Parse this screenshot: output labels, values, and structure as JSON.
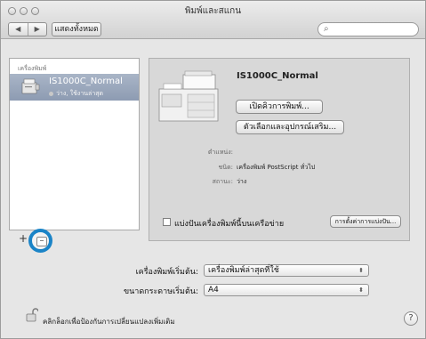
{
  "window": {
    "title": "พิมพ์และสแกน"
  },
  "toolbar": {
    "back_icon": "back-arrow-icon",
    "forward_icon": "forward-arrow-icon",
    "show_all_label": "แสดงทั้งหมด",
    "search_placeholder": ""
  },
  "sidebar": {
    "header": "เครื่องพิมพ์",
    "printers": [
      {
        "name": "IS1000C_Normal",
        "status": "ว่าง, ใช้งานล่าสุด",
        "selected": true
      }
    ],
    "add_label": "+",
    "remove_label": "–"
  },
  "detail": {
    "printer_name": "IS1000C_Normal",
    "open_queue_label": "เปิดคิวการพิมพ์...",
    "options_supplies_label": "ตัวเลือกและอุปกรณ์เสริม...",
    "location_label": "ตำแหน่ง:",
    "location_value": "",
    "kind_label": "ชนิด:",
    "kind_value": "เครื่องพิมพ์ PostScript ทั่วไป",
    "status_label": "สถานะ:",
    "status_value": "ว่าง",
    "share_label": "แบ่งปันเครื่องพิมพ์นี้บนเครือข่าย",
    "share_checked": false,
    "sharing_prefs_label": "การตั้งค่าการแบ่งปัน..."
  },
  "defaults": {
    "default_printer_label": "เครื่องพิมพ์เริ่มต้น:",
    "default_printer_value": "เครื่องพิมพ์ล่าสุดที่ใช้",
    "default_paper_label": "ขนาดกระดาษเริ่มต้น:",
    "default_paper_value": "A4"
  },
  "footer": {
    "lock_text": "คลิกล็อกเพื่อป้องกันการเปลี่ยนแปลงเพิ่มเติม",
    "help_label": "?"
  },
  "colors": {
    "highlight_ring": "#1b84c7",
    "selection": "#9aa7bd"
  }
}
